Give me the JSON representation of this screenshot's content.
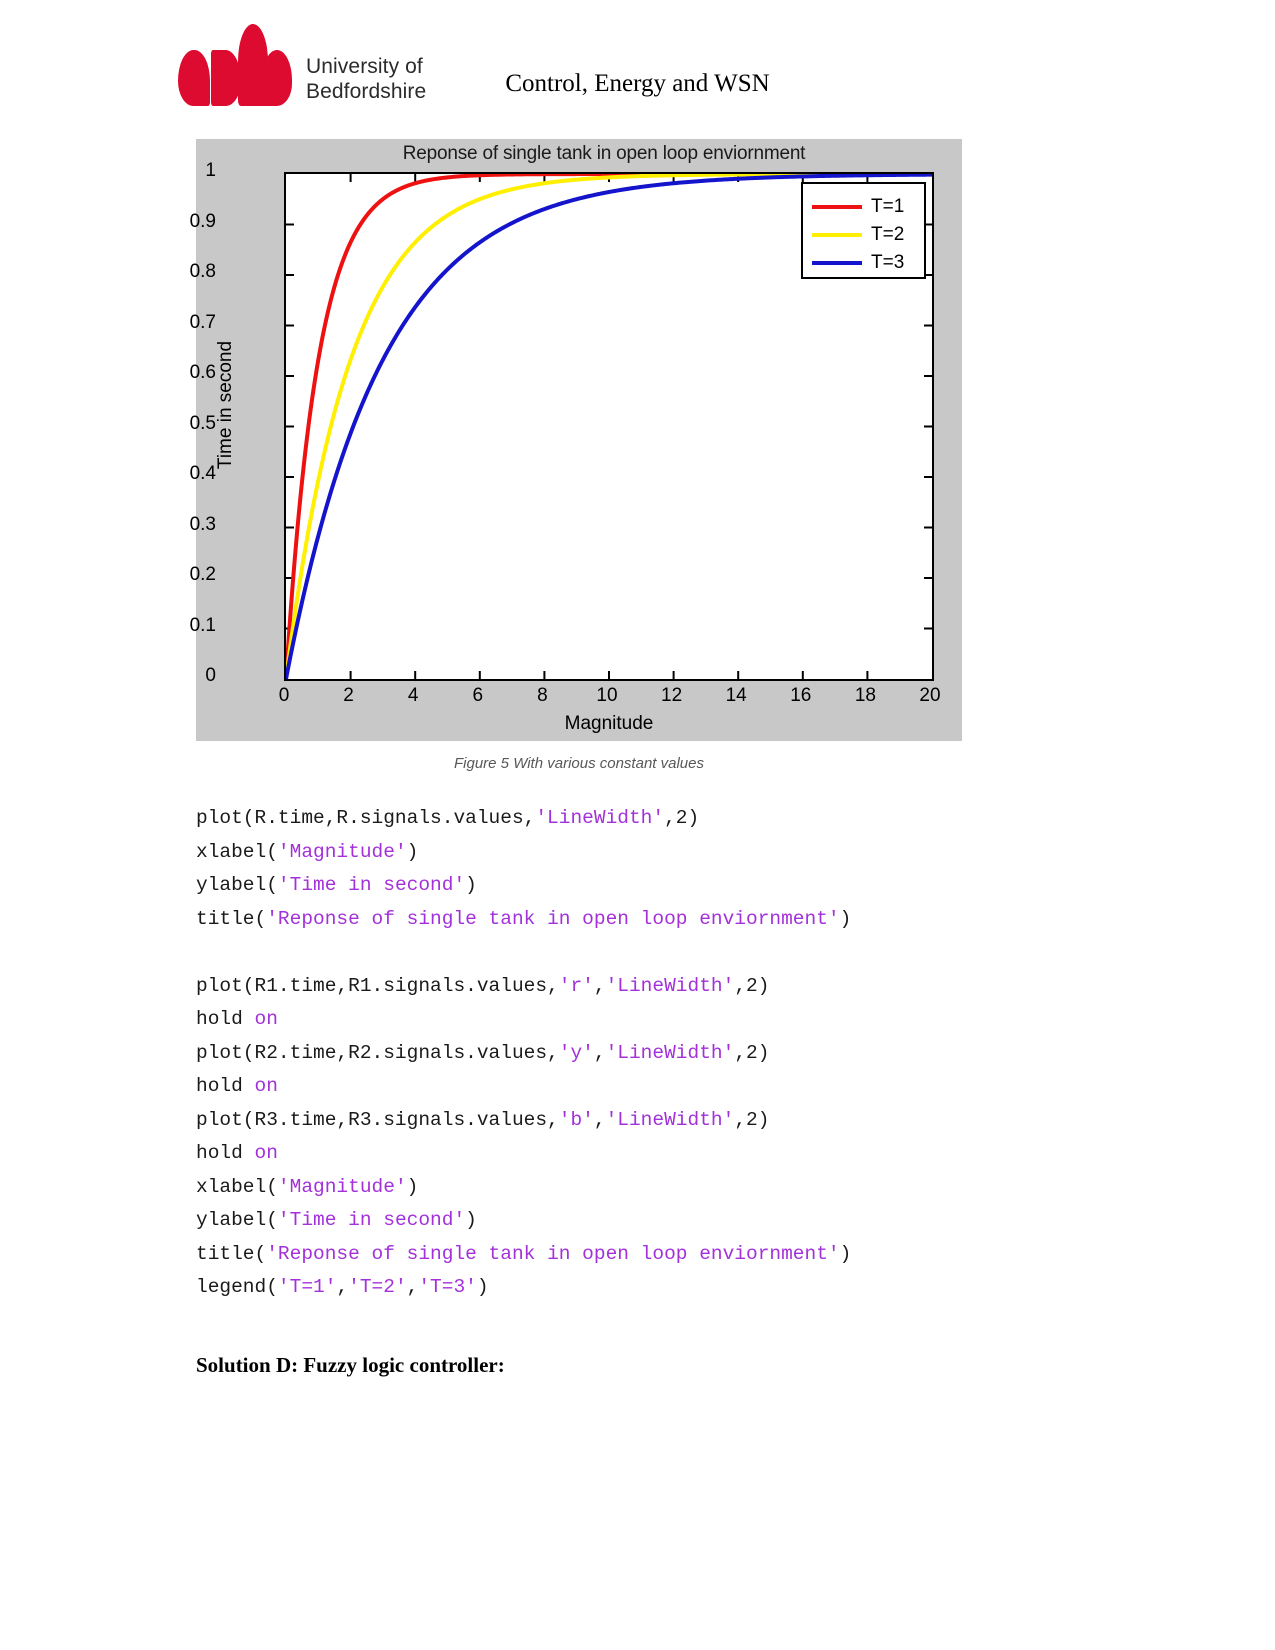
{
  "header": {
    "logo_line1": "University of",
    "logo_line2": "Bedfordshire",
    "logo_alt": "university-of-bedfordshire-logo",
    "title": "Control, Energy and WSN"
  },
  "figure": {
    "caption": "Figure 5 With various constant values"
  },
  "chart_data": {
    "type": "line",
    "title": "Reponse of single tank in open loop enviornment",
    "xlabel": "Magnitude",
    "ylabel": "Time in second",
    "xlim": [
      0,
      20
    ],
    "ylim": [
      0,
      1
    ],
    "xticks": [
      "0",
      "2",
      "4",
      "6",
      "8",
      "10",
      "12",
      "14",
      "16",
      "18",
      "20"
    ],
    "yticks": [
      "0",
      "0.1",
      "0.2",
      "0.3",
      "0.4",
      "0.5",
      "0.6",
      "0.7",
      "0.8",
      "0.9",
      "1"
    ],
    "grid": false,
    "legend_position": "upper right",
    "background": "#c8c8c8",
    "plot_background": "#ffffff",
    "x": [
      0,
      0.25,
      0.5,
      0.75,
      1,
      1.5,
      2,
      2.5,
      3,
      3.5,
      4,
      5,
      6,
      7,
      8,
      9,
      10,
      11,
      12,
      13,
      14,
      15,
      16,
      17,
      18,
      19,
      20
    ],
    "series": [
      {
        "name": "T=1",
        "color": "#ee1111",
        "values": [
          0,
          0.221,
          0.393,
          0.528,
          0.632,
          0.777,
          0.865,
          0.918,
          0.95,
          0.97,
          0.982,
          0.993,
          0.998,
          0.999,
          1,
          1,
          1,
          1,
          1,
          1,
          1,
          1,
          1,
          1,
          1,
          1,
          1
        ]
      },
      {
        "name": "T=2",
        "color": "#ffef00",
        "values": [
          0,
          0.118,
          0.221,
          0.313,
          0.393,
          0.528,
          0.632,
          0.713,
          0.777,
          0.826,
          0.865,
          0.918,
          0.95,
          0.97,
          0.982,
          0.989,
          0.993,
          0.996,
          0.998,
          0.998,
          0.999,
          1,
          1,
          1,
          1,
          1,
          1
        ]
      },
      {
        "name": "T=3",
        "color": "#1414cc",
        "values": [
          0,
          0.08,
          0.154,
          0.221,
          0.283,
          0.393,
          0.487,
          0.565,
          0.632,
          0.688,
          0.736,
          0.811,
          0.865,
          0.903,
          0.931,
          0.95,
          0.964,
          0.974,
          0.982,
          0.987,
          0.991,
          0.993,
          0.995,
          0.997,
          0.998,
          0.998,
          0.999
        ]
      }
    ],
    "legend_entries": [
      {
        "label": "T=1",
        "color": "#ee1111"
      },
      {
        "label": "T=2",
        "color": "#ffef00"
      },
      {
        "label": "T=3",
        "color": "#1414cc"
      }
    ]
  },
  "code": {
    "lines": [
      [
        {
          "t": "plot(R.time,R.signals.values,",
          "c": "plain"
        },
        {
          "t": "'LineWidth'",
          "c": "str"
        },
        {
          "t": ",2)",
          "c": "plain"
        }
      ],
      [
        {
          "t": "xlabel(",
          "c": "plain"
        },
        {
          "t": "'Magnitude'",
          "c": "str"
        },
        {
          "t": ")",
          "c": "plain"
        }
      ],
      [
        {
          "t": "ylabel(",
          "c": "plain"
        },
        {
          "t": "'Time in second'",
          "c": "str"
        },
        {
          "t": ")",
          "c": "plain"
        }
      ],
      [
        {
          "t": "title(",
          "c": "plain"
        },
        {
          "t": "'Reponse of single tank in open loop enviornment'",
          "c": "str"
        },
        {
          "t": ")",
          "c": "plain"
        }
      ],
      [],
      [
        {
          "t": "plot(R1.time,R1.signals.values,",
          "c": "plain"
        },
        {
          "t": "'r'",
          "c": "str"
        },
        {
          "t": ",",
          "c": "plain"
        },
        {
          "t": "'LineWidth'",
          "c": "str"
        },
        {
          "t": ",2)",
          "c": "plain"
        }
      ],
      [
        {
          "t": "hold ",
          "c": "plain"
        },
        {
          "t": "on",
          "c": "kw"
        }
      ],
      [
        {
          "t": "plot(R2.time,R2.signals.values,",
          "c": "plain"
        },
        {
          "t": "'y'",
          "c": "str"
        },
        {
          "t": ",",
          "c": "plain"
        },
        {
          "t": "'LineWidth'",
          "c": "str"
        },
        {
          "t": ",2)",
          "c": "plain"
        }
      ],
      [
        {
          "t": "hold ",
          "c": "plain"
        },
        {
          "t": "on",
          "c": "kw"
        }
      ],
      [
        {
          "t": "plot(R3.time,R3.signals.values,",
          "c": "plain"
        },
        {
          "t": "'b'",
          "c": "str"
        },
        {
          "t": ",",
          "c": "plain"
        },
        {
          "t": "'LineWidth'",
          "c": "str"
        },
        {
          "t": ",2)",
          "c": "plain"
        }
      ],
      [
        {
          "t": "hold ",
          "c": "plain"
        },
        {
          "t": "on",
          "c": "kw"
        }
      ],
      [
        {
          "t": "xlabel(",
          "c": "plain"
        },
        {
          "t": "'Magnitude'",
          "c": "str"
        },
        {
          "t": ")",
          "c": "plain"
        }
      ],
      [
        {
          "t": "ylabel(",
          "c": "plain"
        },
        {
          "t": "'Time in second'",
          "c": "str"
        },
        {
          "t": ")",
          "c": "plain"
        }
      ],
      [
        {
          "t": "title(",
          "c": "plain"
        },
        {
          "t": "'Reponse of single tank in open loop enviornment'",
          "c": "str"
        },
        {
          "t": ")",
          "c": "plain"
        }
      ],
      [
        {
          "t": "legend(",
          "c": "plain"
        },
        {
          "t": "'T=1'",
          "c": "str"
        },
        {
          "t": ",",
          "c": "plain"
        },
        {
          "t": "'T=2'",
          "c": "str"
        },
        {
          "t": ",",
          "c": "plain"
        },
        {
          "t": "'T=3'",
          "c": "str"
        },
        {
          "t": ")",
          "c": "plain"
        }
      ]
    ]
  },
  "solution_heading": "Solution D: Fuzzy logic controller:"
}
